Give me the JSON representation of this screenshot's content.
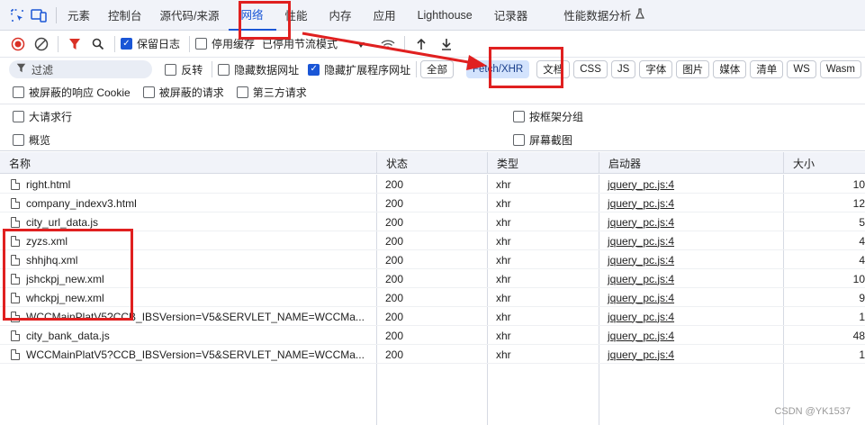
{
  "tabs": [
    {
      "label": "元素"
    },
    {
      "label": "控制台"
    },
    {
      "label": "源代码/来源"
    },
    {
      "label": "网络"
    },
    {
      "label": "性能"
    },
    {
      "label": "内存"
    },
    {
      "label": "应用"
    },
    {
      "label": "Lighthouse"
    },
    {
      "label": "记录器"
    },
    {
      "label": "性能数据分析"
    }
  ],
  "toolbar": {
    "preserve_log": "保留日志",
    "disable_cache": "停用缓存",
    "throttle": "已停用节流模式"
  },
  "filter": {
    "placeholder": "过滤",
    "invert": "反转",
    "hide_data_urls": "隐藏数据网址",
    "hide_extension_urls": "隐藏扩展程序网址"
  },
  "type_pills": [
    "全部",
    "Fetch/XHR",
    "文档",
    "CSS",
    "JS",
    "字体",
    "图片",
    "媒体",
    "清单",
    "WS",
    "Wasm"
  ],
  "options_row": {
    "blocked_cookies": "被屏蔽的响应 Cookie",
    "blocked_requests": "被屏蔽的请求",
    "third_party": "第三方请求"
  },
  "settings": {
    "large_rows": "大请求行",
    "group_by_frame": "按框架分组",
    "overview": "概览",
    "screenshots": "屏幕截图"
  },
  "columns": {
    "name": "名称",
    "status": "状态",
    "type": "类型",
    "initiator": "启动器",
    "size": "大小"
  },
  "rows": [
    {
      "name": "right.html",
      "status": "200",
      "type": "xhr",
      "initiator": "jquery_pc.js:4",
      "size": "10"
    },
    {
      "name": "company_indexv3.html",
      "status": "200",
      "type": "xhr",
      "initiator": "jquery_pc.js:4",
      "size": "12"
    },
    {
      "name": "city_url_data.js",
      "status": "200",
      "type": "xhr",
      "initiator": "jquery_pc.js:4",
      "size": "5"
    },
    {
      "name": "zyzs.xml",
      "status": "200",
      "type": "xhr",
      "initiator": "jquery_pc.js:4",
      "size": "4"
    },
    {
      "name": "shhjhq.xml",
      "status": "200",
      "type": "xhr",
      "initiator": "jquery_pc.js:4",
      "size": "4"
    },
    {
      "name": "jshckpj_new.xml",
      "status": "200",
      "type": "xhr",
      "initiator": "jquery_pc.js:4",
      "size": "10"
    },
    {
      "name": "whckpj_new.xml",
      "status": "200",
      "type": "xhr",
      "initiator": "jquery_pc.js:4",
      "size": "9"
    },
    {
      "name": "WCCMainPlatV5?CCB_IBSVersion=V5&SERVLET_NAME=WCCMa...",
      "status": "200",
      "type": "xhr",
      "initiator": "jquery_pc.js:4",
      "size": "1"
    },
    {
      "name": "city_bank_data.js",
      "status": "200",
      "type": "xhr",
      "initiator": "jquery_pc.js:4",
      "size": "48"
    },
    {
      "name": "WCCMainPlatV5?CCB_IBSVersion=V5&SERVLET_NAME=WCCMa...",
      "status": "200",
      "type": "xhr",
      "initiator": "jquery_pc.js:4",
      "size": "1"
    }
  ],
  "watermark": "CSDN @YK1537",
  "colors": {
    "accent": "#1a56d6",
    "annotation_red": "#e02020",
    "record_red": "#d93025"
  }
}
